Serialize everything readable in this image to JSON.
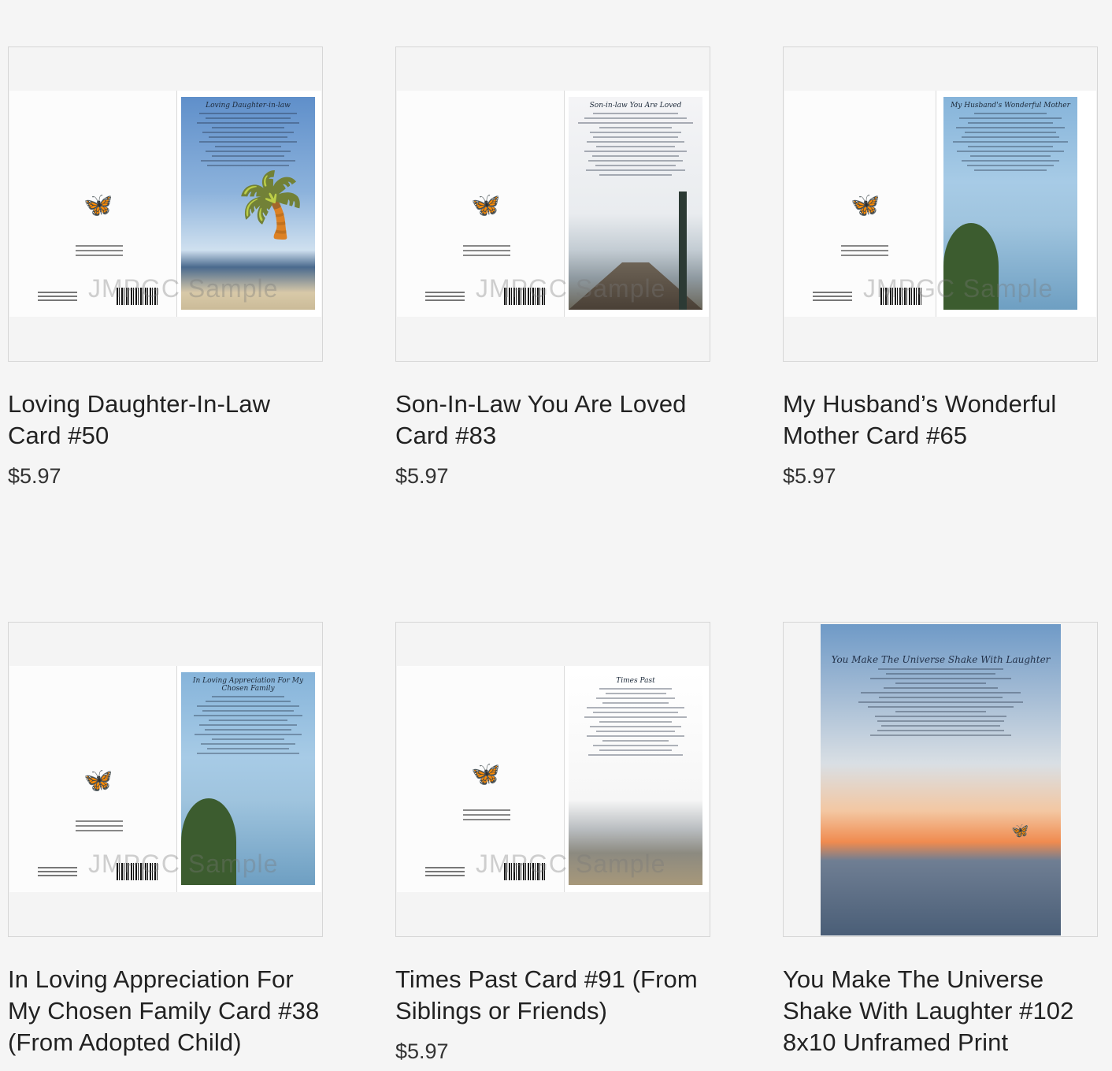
{
  "products": [
    {
      "title": "Loving Daughter-In-Law Card #50",
      "price": "$5.97",
      "card_heading": "Loving Daughter-in-law",
      "watermark": "JMPGC Sample",
      "scene": "palm"
    },
    {
      "title": "Son-In-Law You Are Loved Card #83",
      "price": "$5.97",
      "card_heading": "Son-in-law You Are Loved",
      "watermark": "JMPGC Sample",
      "scene": "dock"
    },
    {
      "title": "My Husband’s Wonderful Mother Card #65",
      "price": "$5.97",
      "card_heading": "My Husband's Wonderful Mother",
      "watermark": "JMPGC Sample",
      "scene": "sea"
    },
    {
      "title": "In Loving Appreciation For My Chosen Family Card #38 (From Adopted Child)",
      "price": "",
      "card_heading": "In Loving Appreciation For My Chosen Family",
      "watermark": "JMPGC Sample",
      "scene": "sea"
    },
    {
      "title": "Times Past Card #91 (From Siblings or Friends)",
      "price": "$5.97",
      "card_heading": "Times Past",
      "watermark": "JMPGC Sample",
      "scene": "beach"
    },
    {
      "title": "You Make The Universe Shake With Laughter #102 8x10 Unframed Print",
      "price": "",
      "card_heading": "You Make The Universe Shake With Laughter",
      "watermark": "",
      "scene": "sunset"
    }
  ]
}
